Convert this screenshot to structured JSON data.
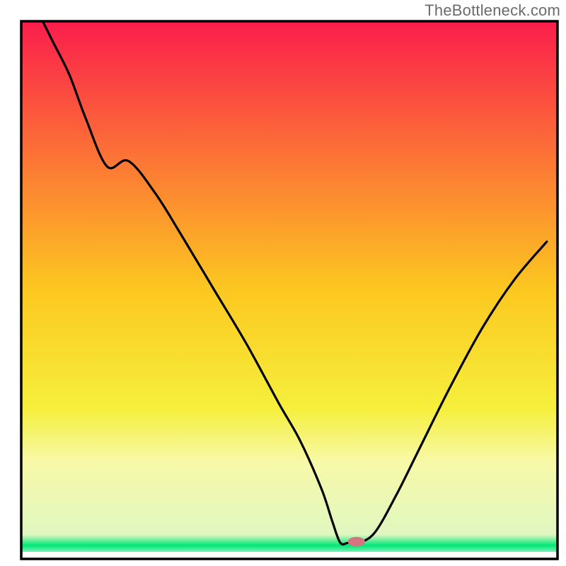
{
  "attribution": "TheBottleneck.com",
  "chart_data": {
    "type": "line",
    "title": "",
    "xlabel": "",
    "ylabel": "",
    "xlim": [
      0,
      100
    ],
    "ylim": [
      0,
      100
    ],
    "grid": false,
    "legend": false,
    "background": {
      "gradient_stops": [
        {
          "offset": 0.0,
          "color": "#fb1d4c"
        },
        {
          "offset": 0.5,
          "color": "#fcc820"
        },
        {
          "offset": 0.72,
          "color": "#f6ef3c"
        },
        {
          "offset": 0.82,
          "color": "#f7f9a8"
        },
        {
          "offset": 0.955,
          "color": "#e0f7c0"
        },
        {
          "offset": 0.975,
          "color": "#00e676"
        },
        {
          "offset": 1.0,
          "color": "#ffffff"
        }
      ]
    },
    "series": [
      {
        "name": "main-curve",
        "x": [
          4,
          6,
          9,
          12,
          16,
          20,
          25,
          30,
          36,
          42,
          48,
          52,
          56,
          58,
          59.5,
          61,
          63,
          66,
          70,
          74,
          80,
          86,
          92,
          98
        ],
        "y": [
          100,
          96,
          90,
          82,
          73,
          74,
          68,
          60,
          50,
          40,
          29,
          22,
          13,
          7,
          3,
          3,
          3,
          5,
          12,
          20,
          32,
          43,
          52,
          59
        ]
      }
    ],
    "marker": {
      "x": 62.5,
      "y": 3.2,
      "rx": 1.6,
      "ry": 0.9,
      "color": "#d6747f"
    },
    "frame": {
      "stroke": "#000000",
      "stroke_width": 3.5
    }
  }
}
